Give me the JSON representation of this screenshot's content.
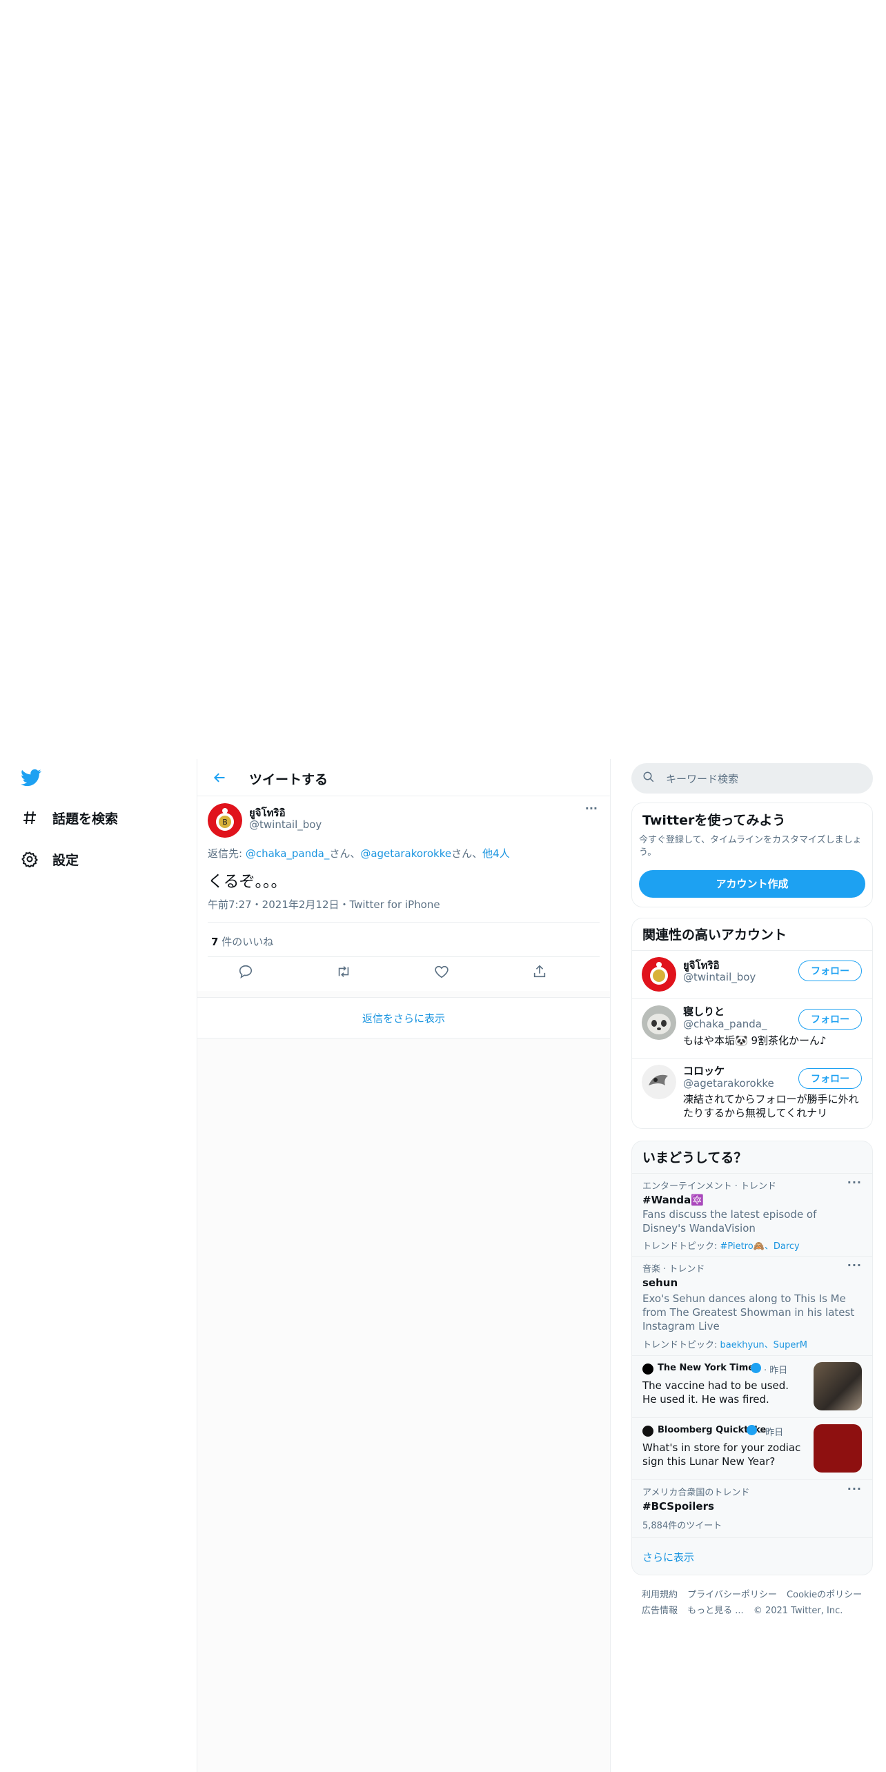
{
  "nav": {
    "logo": "twitter-bird-icon",
    "items": [
      {
        "label": "話題を検索",
        "icon": "hashtag-icon"
      },
      {
        "label": "設定",
        "icon": "gear-icon"
      }
    ]
  },
  "header": {
    "title": "ツイートする"
  },
  "tweet": {
    "author_name": "ยูจิโทริอิ",
    "author_handle": "@twintail_boy",
    "reply_prefix": "返信先: ",
    "reply_user1": "@chaka_panda_",
    "reply_san1": "さん、",
    "reply_user2": "@agetarakorokke",
    "reply_san2": "さん、",
    "reply_others": "他4人",
    "text": "くるぞ。。。",
    "meta": "午前7:27・2021年2月12日・Twitter for iPhone",
    "likes_count": "7",
    "likes_label": " 件のいいね",
    "more_label": "···"
  },
  "more_replies": "返信をさらに表示",
  "search": {
    "placeholder": "キーワード検索"
  },
  "signup": {
    "title": "Twitterを使ってみよう",
    "desc": "今すぐ登録して、タイムラインをカスタマイズしましょう。",
    "button": "アカウント作成"
  },
  "related": {
    "title": "関連性の高いアカウント",
    "follow_label": "フォロー",
    "accounts": [
      {
        "name": "ยูจิโทริอิ",
        "handle": "@twintail_boy",
        "bio": ""
      },
      {
        "name": "寝しりと",
        "handle": "@chaka_panda_",
        "bio": "もはや本垢🐼 9割茶化かーん♪"
      },
      {
        "name": "コロッケ",
        "handle": "@agetarakorokke",
        "bio": "凍結されてからフォローが勝手に外れたりするから無視してくれナリ"
      }
    ]
  },
  "trends": {
    "title": "いまどうしてる？",
    "items": [
      {
        "category": "エンターテインメント · トレンド",
        "name": "#Wanda",
        "emoji": "🔯",
        "desc": "Fans discuss the latest episode of Disney's WandaVision",
        "topics_label": "トレンドトピック: ",
        "topics": "#Pietro🙈、Darcy"
      },
      {
        "category": "音楽 · トレンド",
        "name": "sehun",
        "desc": "Exo's Sehun dances along to This Is Me from The Greatest Showman in his latest Instagram Live",
        "topics_label": "トレンドトピック: ",
        "topics": "baekhyun、SuperM"
      }
    ],
    "news": [
      {
        "source": "The New York Times",
        "time": "· 昨日",
        "headline": "The vaccine had to be used. He used it. He was fired."
      },
      {
        "source": "Bloomberg Quicktake",
        "time": "· 昨日",
        "headline": "What's in store for your zodiac sign this Lunar New Year?"
      }
    ],
    "last": {
      "category": "アメリカ合衆国のトレンド",
      "name": "#BCSpoilers",
      "count": "5,884件のツイート"
    },
    "show_more": "さらに表示"
  },
  "footer": {
    "line1": [
      "利用規約",
      "プライバシーポリシー",
      "Cookieのポリシー"
    ],
    "line2": [
      "広告情報",
      "もっと見る ...",
      "© 2021 Twitter, Inc."
    ]
  },
  "colors": {
    "accent": "#1da1f2",
    "link": "#1b95e0",
    "muted": "#5b7083"
  }
}
